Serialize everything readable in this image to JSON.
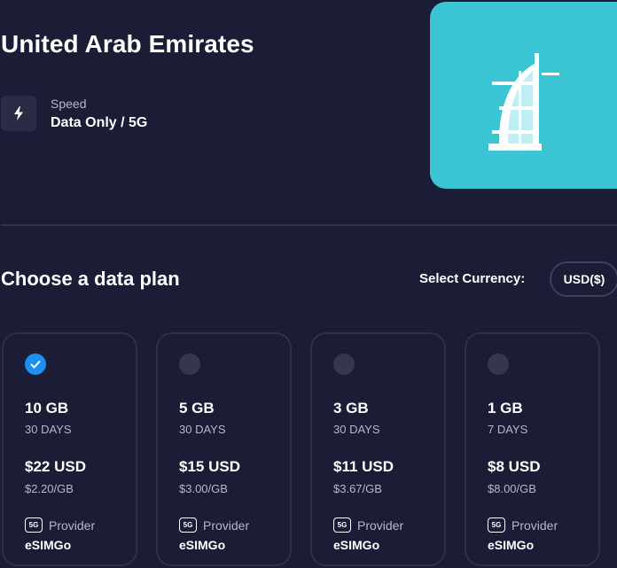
{
  "country": {
    "title": "United Arab Emirates"
  },
  "speed": {
    "label": "Speed",
    "value": "Data Only / 5G",
    "icon": "lightning-icon"
  },
  "hero": {
    "icon": "burj-al-arab-icon",
    "background": "#3bc4d4"
  },
  "plans_section": {
    "title": "Choose a data plan",
    "currency_label": "Select Currency:",
    "currency_value": "USD($)"
  },
  "plans": [
    {
      "data": "10 GB",
      "days": "30 DAYS",
      "price": "$22 USD",
      "per_gb": "$2.20/GB",
      "badge": "5G",
      "provider_label": "Provider",
      "provider": "eSIMGo",
      "selected": true
    },
    {
      "data": "5 GB",
      "days": "30 DAYS",
      "price": "$15 USD",
      "per_gb": "$3.00/GB",
      "badge": "5G",
      "provider_label": "Provider",
      "provider": "eSIMGo",
      "selected": false
    },
    {
      "data": "3 GB",
      "days": "30 DAYS",
      "price": "$11 USD",
      "per_gb": "$3.67/GB",
      "badge": "5G",
      "provider_label": "Provider",
      "provider": "eSIMGo",
      "selected": false
    },
    {
      "data": "1 GB",
      "days": "7 DAYS",
      "price": "$8 USD",
      "per_gb": "$8.00/GB",
      "badge": "5G",
      "provider_label": "Provider",
      "provider": "eSIMGo",
      "selected": false
    }
  ],
  "colors": {
    "background": "#1b1c36",
    "accent": "#1e8ef0",
    "card_border": "#2e3049"
  }
}
